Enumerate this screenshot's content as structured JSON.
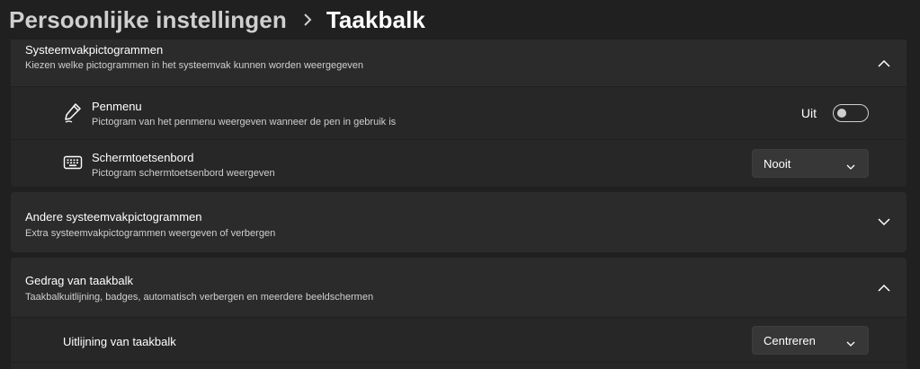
{
  "breadcrumb": {
    "parent": "Persoonlijke instellingen",
    "separator_icon": "chevron-right-icon",
    "current": "Taakbalk"
  },
  "tray_icons": {
    "title": "Systeemvakpictogrammen",
    "description": "Kiezen welke pictogrammen in het systeemvak kunnen worden weergegeven",
    "expanded": true,
    "items": [
      {
        "icon": "pen-icon",
        "title": "Penmenu",
        "description": "Pictogram van het penmenu weergeven wanneer de pen in gebruik is",
        "control": "toggle",
        "state_label": "Uit",
        "on": false
      },
      {
        "icon": "keyboard-icon",
        "title": "Schermtoetsenbord",
        "description": "Pictogram schermtoetsenbord weergeven",
        "control": "dropdown",
        "value": "Nooit"
      }
    ]
  },
  "other_tray_icons": {
    "title": "Andere systeemvakpictogrammen",
    "description": "Extra systeemvakpictogrammen weergeven of verbergen",
    "expanded": false
  },
  "taskbar_behavior": {
    "title": "Gedrag van taakbalk",
    "description": "Taakbalkuitlijning, badges, automatisch verbergen en meerdere beeldschermen",
    "expanded": true,
    "items": [
      {
        "title": "Uitlijning van taakbalk",
        "control": "dropdown",
        "value": "Centreren"
      }
    ]
  },
  "colors": {
    "background": "#202020",
    "card": "#2b2b2b",
    "subrow": "#272727",
    "text": "#ffffff",
    "secondary_text": "#cfcfcf"
  }
}
